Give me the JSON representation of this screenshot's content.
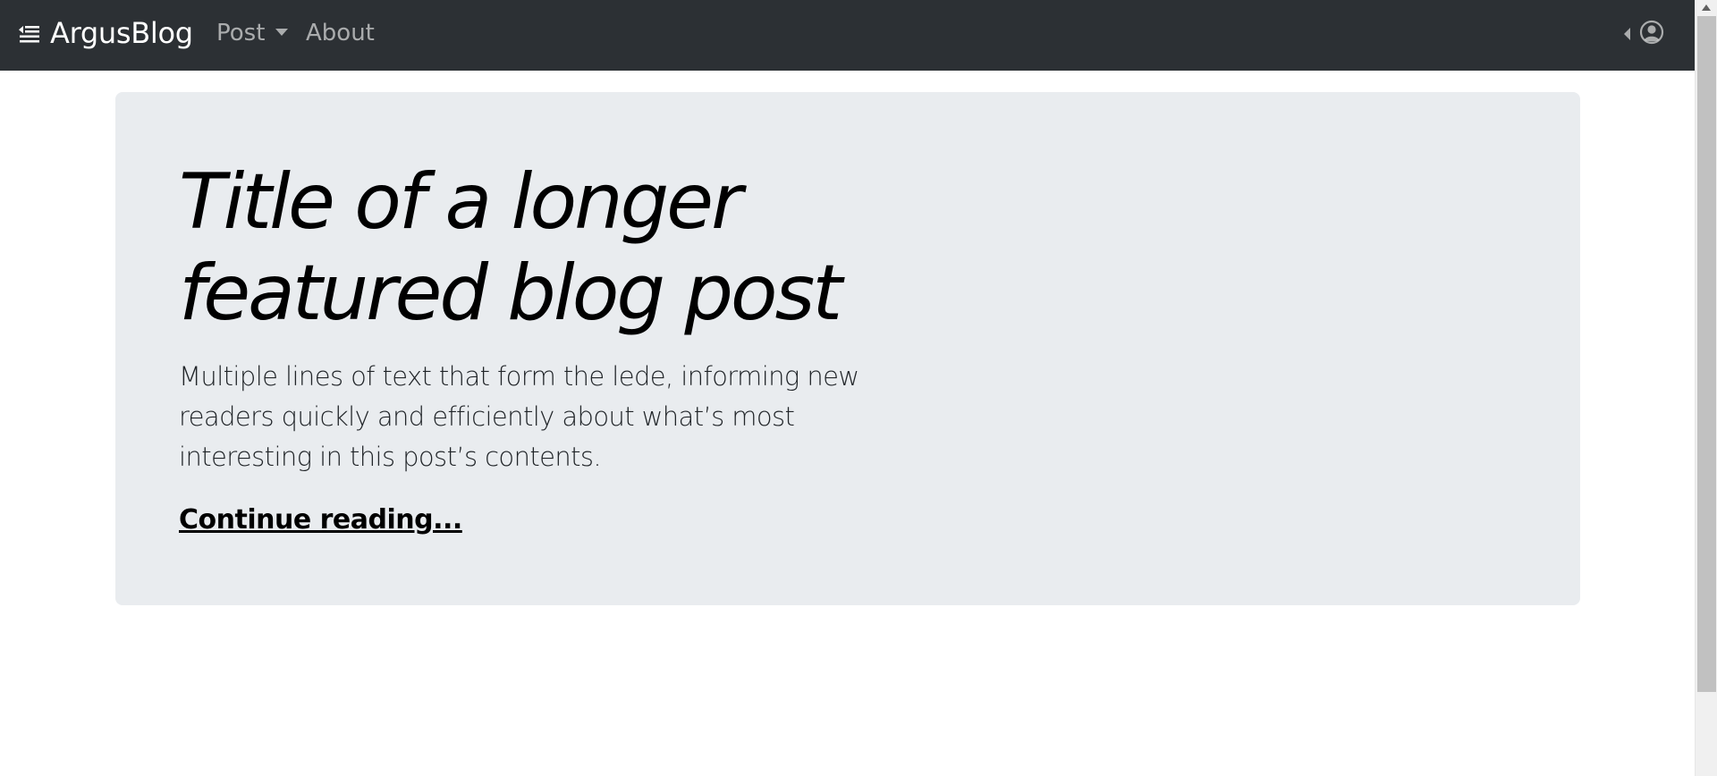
{
  "navbar": {
    "toggle_icon": "sidebar-toggle-icon",
    "brand": "ArgusBlog",
    "items": [
      {
        "label": "Post",
        "has_dropdown": true
      },
      {
        "label": "About",
        "has_dropdown": false
      }
    ],
    "user_icon": "user-circle-icon",
    "background": "#2c3034"
  },
  "hero": {
    "title": "Title of a longer featured blog post",
    "lede": "Multiple lines of text that form the lede, informing new readers quickly and efficiently about what’s most interesting in this post’s contents.",
    "link_label": "Continue reading...",
    "background": "#e9ecef"
  }
}
